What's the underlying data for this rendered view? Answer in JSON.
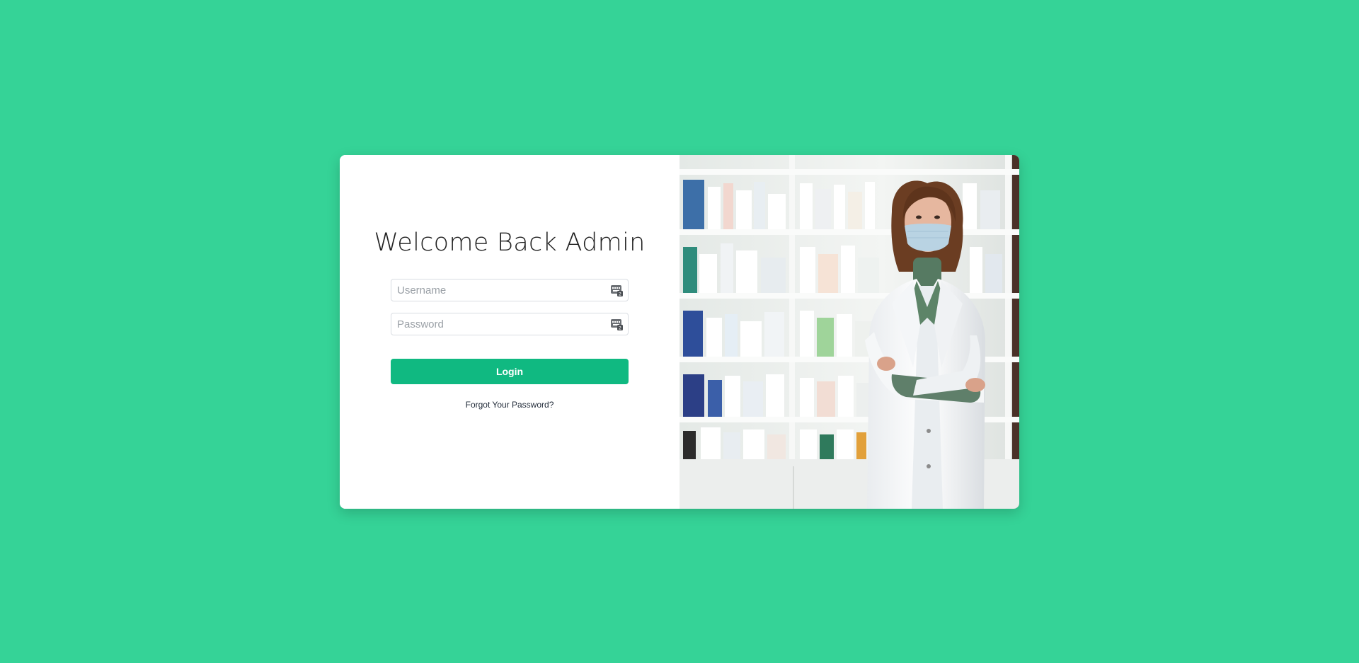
{
  "login": {
    "title": "Welcome Back Admin",
    "username_placeholder": "Username",
    "password_placeholder": "Password",
    "login_label": "Login",
    "forgot_label": "Forgot Your Password?"
  },
  "image": {
    "subject": "pharmacist-photo"
  },
  "colors": {
    "background": "#35d397",
    "button": "#10b981"
  }
}
